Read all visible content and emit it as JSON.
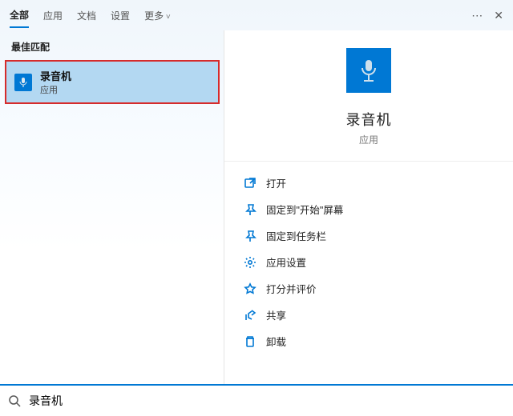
{
  "tabs": {
    "all": "全部",
    "apps": "应用",
    "docs": "文档",
    "settings": "设置",
    "more": "更多"
  },
  "left": {
    "section_hdr": "最佳匹配",
    "result": {
      "title": "录音机",
      "subtitle": "应用"
    }
  },
  "detail": {
    "title": "录音机",
    "subtitle": "应用",
    "actions": {
      "open": "打开",
      "pin_start": "固定到\"开始\"屏幕",
      "pin_taskbar": "固定到任务栏",
      "app_settings": "应用设置",
      "rate": "打分并评价",
      "share": "共享",
      "uninstall": "卸载"
    }
  },
  "search": {
    "value": "录音机"
  }
}
